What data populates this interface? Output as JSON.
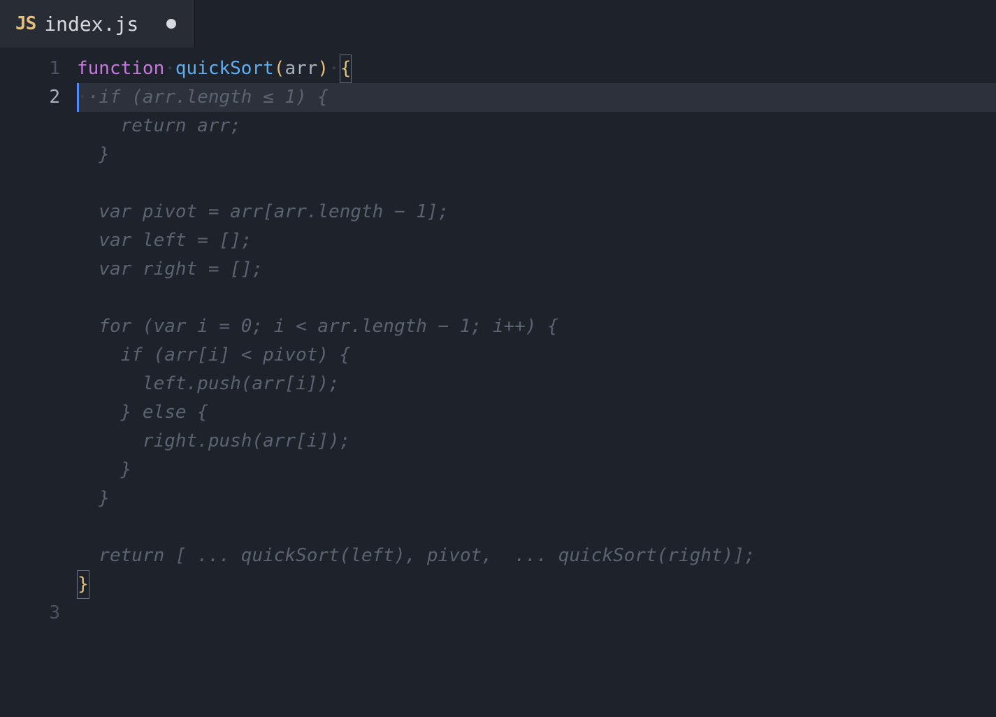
{
  "tab": {
    "icon_text": "JS",
    "filename": "index.js",
    "modified": true
  },
  "gutter": {
    "numbers": [
      "1",
      "2",
      "3"
    ],
    "active_index": 1
  },
  "code": {
    "line1": {
      "keyword": "function",
      "space_dot": "·",
      "func_name": "quickSort",
      "paren_open": "(",
      "param": "arr",
      "paren_close": ")",
      "space_dot2": "·",
      "brace_open": "{"
    },
    "line2_whitespace": "·",
    "line3_brace_close": "}",
    "ghost_lines": [
      "·if (arr.length ≤ 1) {",
      "    return arr;",
      "  }",
      "",
      "  var pivot = arr[arr.length − 1];",
      "  var left = [];",
      "  var right = [];",
      "",
      "  for (var i = 0; i < arr.length − 1; i++) {",
      "    if (arr[i] < pivot) {",
      "      left.push(arr[i]);",
      "    } else {",
      "      right.push(arr[i]);",
      "    }",
      "  }",
      "",
      "  return [ ... quickSort(left), pivot,  ... quickSort(right)];"
    ]
  }
}
